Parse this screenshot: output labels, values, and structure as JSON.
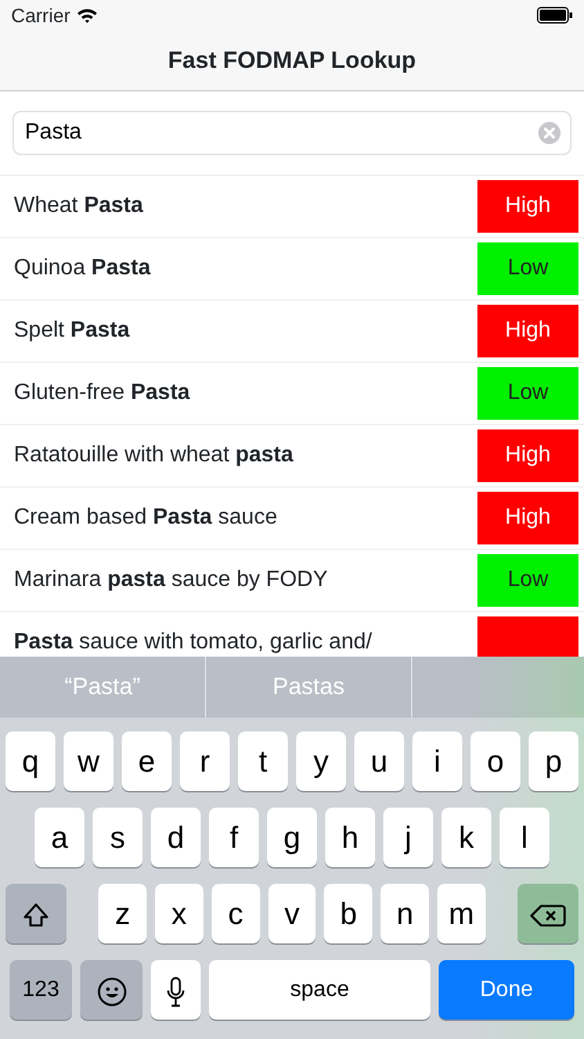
{
  "status_bar": {
    "carrier": "Carrier"
  },
  "nav": {
    "title": "Fast FODMAP Lookup"
  },
  "search": {
    "value": "Pasta"
  },
  "results": [
    {
      "name": "Wheat **Pasta**",
      "kind": "high",
      "rating": "High"
    },
    {
      "name": "Quinoa **Pasta**",
      "kind": "low",
      "rating": "Low"
    },
    {
      "name": "Spelt **Pasta**",
      "kind": "high",
      "rating": "High"
    },
    {
      "name": "Gluten-free **Pasta**",
      "kind": "low",
      "rating": "Low"
    },
    {
      "name": "Ratatouille with wheat **pasta**",
      "kind": "high",
      "rating": "High"
    },
    {
      "name": "Cream based **Pasta** sauce",
      "kind": "high",
      "rating": "High"
    },
    {
      "name": "Marinara **pasta** sauce by FODY",
      "kind": "low",
      "rating": "Low"
    },
    {
      "name": "**Pasta** sauce with tomato, garlic and/",
      "kind": "high"
    }
  ],
  "keyboard": {
    "suggestions": [
      "“Pasta”",
      "Pastas"
    ],
    "rows": [
      [
        "q",
        "w",
        "e",
        "r",
        "t",
        "y",
        "u",
        "i",
        "o",
        "p"
      ],
      [
        "a",
        "s",
        "d",
        "f",
        "g",
        "h",
        "j",
        "k",
        "l"
      ],
      [
        "z",
        "x",
        "c",
        "v",
        "b",
        "n",
        "m"
      ]
    ],
    "numbers_key": "123",
    "space_key": "space",
    "done_key": "Done"
  }
}
